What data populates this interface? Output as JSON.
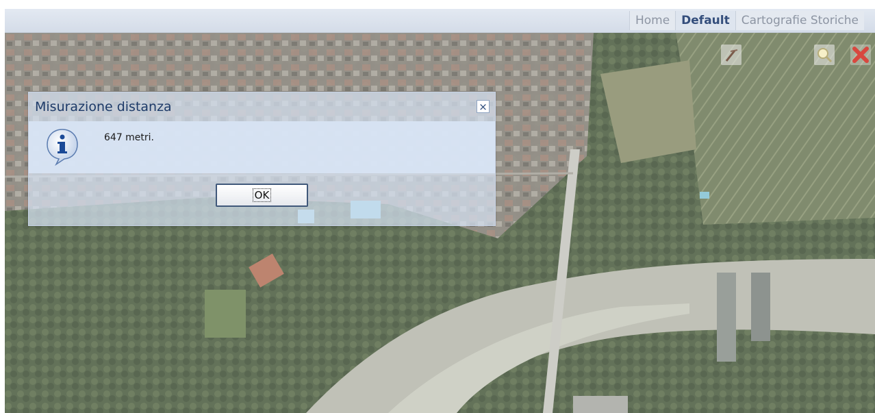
{
  "navbar": {
    "tabs": [
      {
        "label": "Home",
        "active": false
      },
      {
        "label": "Default",
        "active": true
      },
      {
        "label": "Cartografie Storiche",
        "active": false
      }
    ]
  },
  "map": {
    "tools": [
      {
        "icon": "ruler-icon"
      },
      {
        "icon": "zoom-magnifier-icon"
      },
      {
        "icon": "close-red-x-icon"
      }
    ]
  },
  "dialog": {
    "title": "Misurazione distanza",
    "close_label": "×",
    "message": "647 metri.",
    "icon": "info-icon",
    "ok_label": "OK"
  },
  "colors": {
    "dialog_title": "#1d3a68",
    "active_tab": "#344e7c",
    "inactive_tab": "#8d95a3"
  }
}
